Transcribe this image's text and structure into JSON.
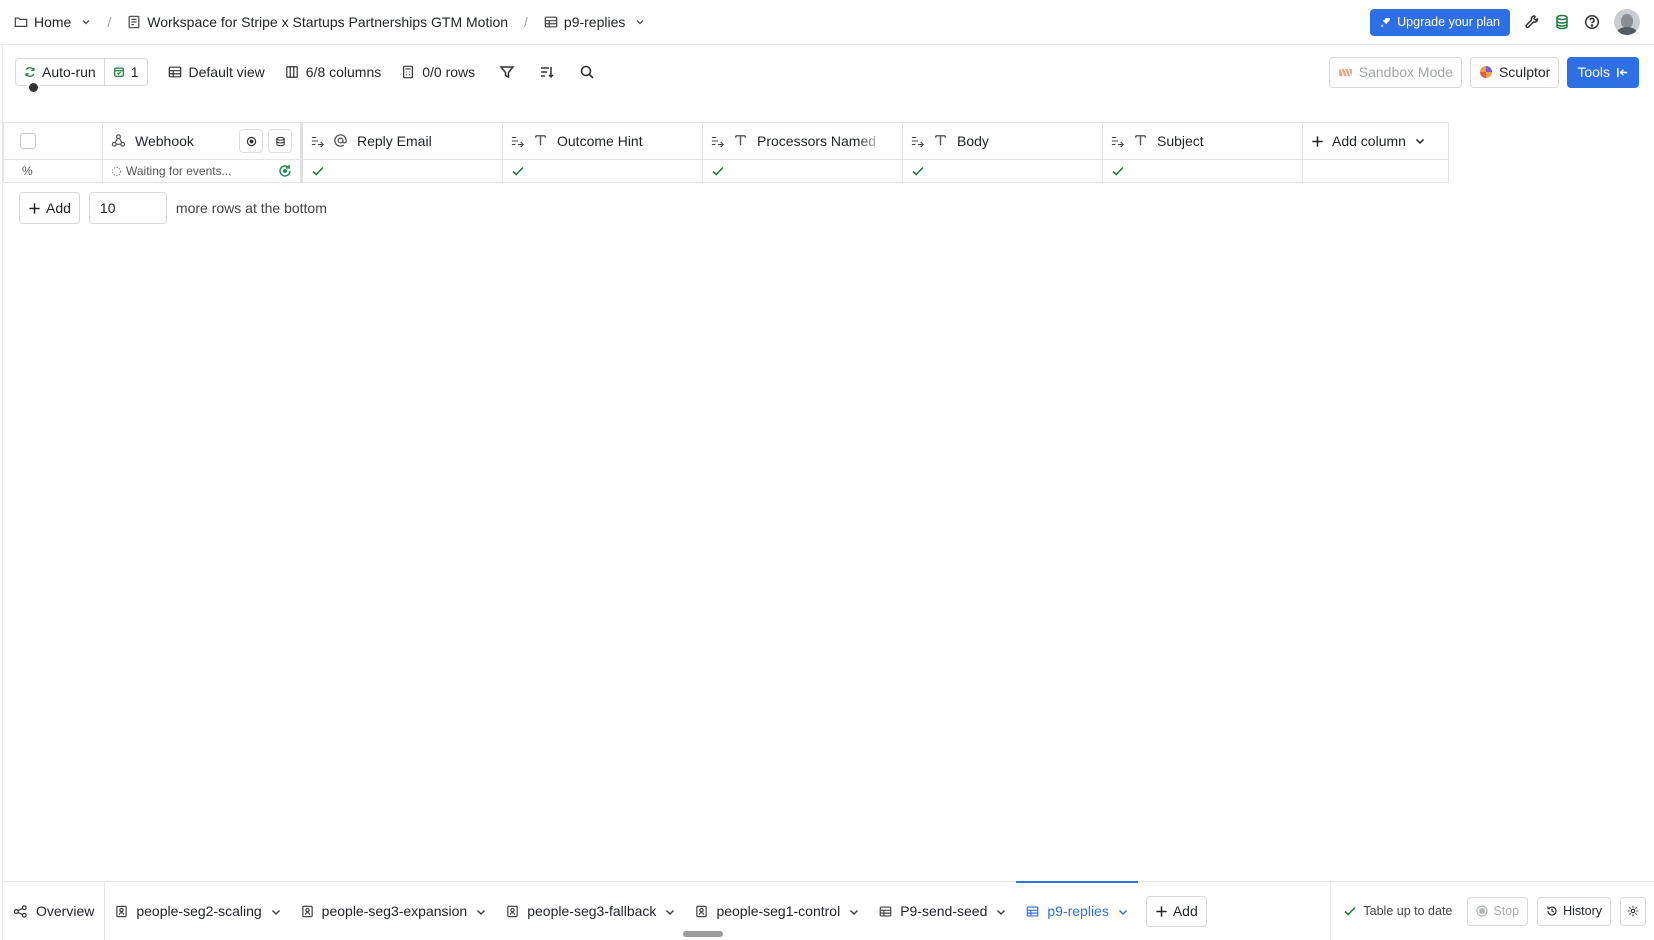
{
  "breadcrumb": {
    "home": "Home",
    "workspace": "Workspace for Stripe x Startups Partnerships GTM Motion",
    "table": "p9-replies",
    "separator": "/"
  },
  "topbar": {
    "upgrade_label": "Upgrade your plan",
    "icons": [
      "wrench-icon",
      "database-icon",
      "help-icon",
      "avatar"
    ]
  },
  "toolbar": {
    "autorun_label": "Auto-run",
    "autorun_count": "1",
    "view_label": "Default view",
    "columns_label": "6/8 columns",
    "rows_label": "0/0 rows",
    "sandbox_label": "Sandbox Mode",
    "sculptor_label": "Sculptor",
    "tools_label": "Tools"
  },
  "table": {
    "columns": [
      {
        "label": "Webhook",
        "type": "webhook-icon"
      },
      {
        "label": "Reply Email",
        "type": "at-icon"
      },
      {
        "label": "Outcome Hint",
        "type": "text-icon"
      },
      {
        "label": "Processors Named",
        "type": "text-icon"
      },
      {
        "label": "Body",
        "type": "text-icon"
      },
      {
        "label": "Subject",
        "type": "text-icon"
      }
    ],
    "add_column_label": "Add column",
    "row0": {
      "index": "%",
      "webhook_status": "Waiting for events..."
    }
  },
  "add_rows": {
    "button_label": "Add",
    "count_value": "10",
    "suffix": "more rows at the bottom"
  },
  "bottom": {
    "overview_label": "Overview",
    "tabs": [
      {
        "label": "people-seg2-scaling"
      },
      {
        "label": "people-seg3-expansion"
      },
      {
        "label": "people-seg3-fallback"
      },
      {
        "label": "people-seg1-control"
      },
      {
        "label": "P9-send-seed"
      },
      {
        "label": "p9-replies"
      }
    ],
    "add_tab_label": "Add",
    "status_label": "Table up to date",
    "stop_label": "Stop",
    "history_label": "History"
  },
  "colors": {
    "accent": "#2f6fe4",
    "success": "#1b7a43",
    "border": "#e3e3e3"
  }
}
